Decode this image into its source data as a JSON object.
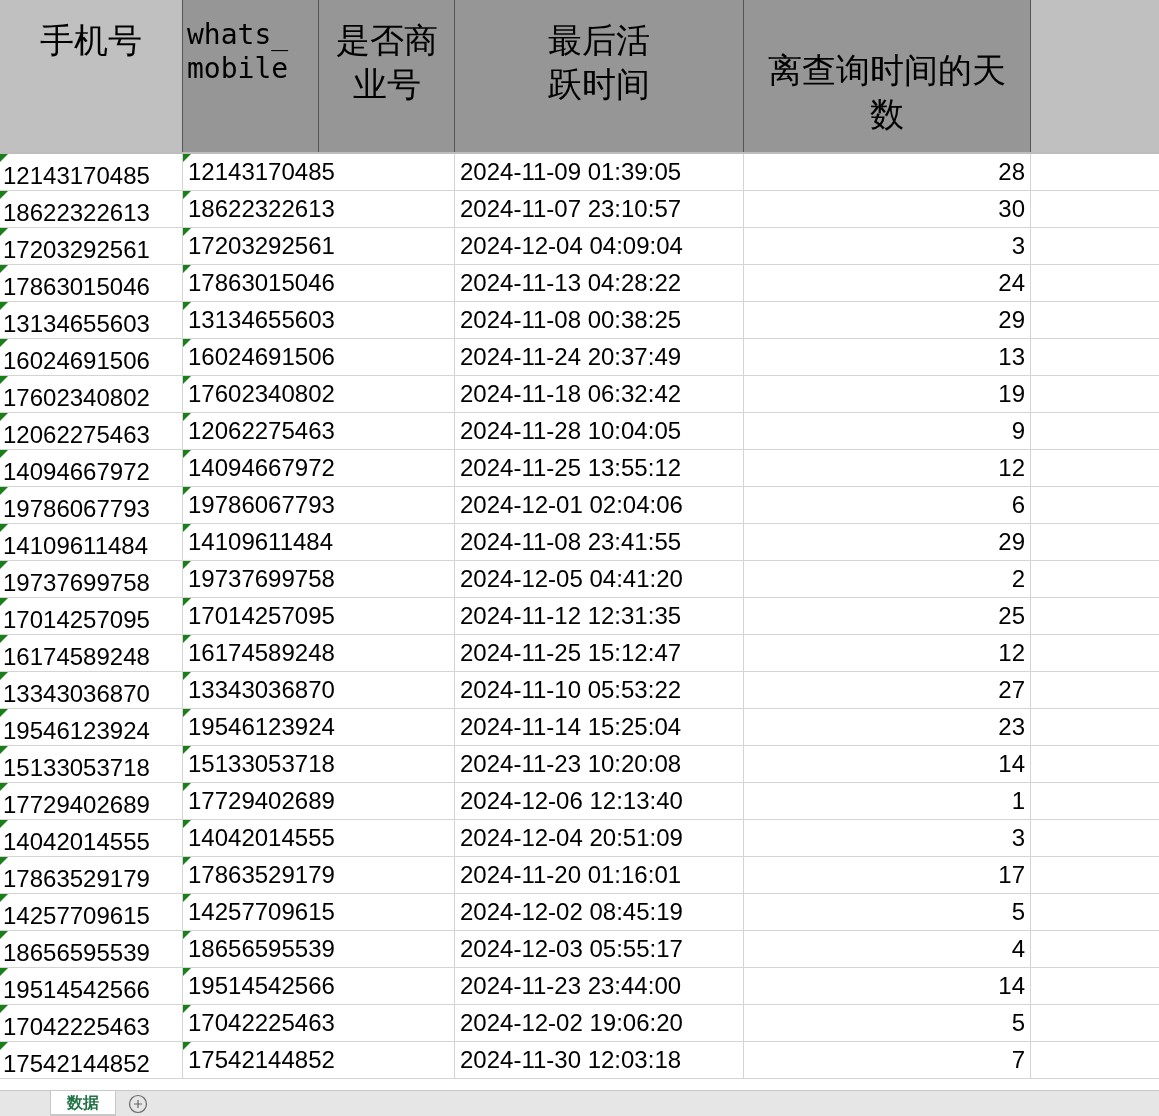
{
  "table": {
    "columns": [
      {
        "label": "手机号",
        "kind": "cjk"
      },
      {
        "label": "whats_mobile",
        "kind": "mono"
      },
      {
        "label": "是否商业号",
        "kind": "cjk"
      },
      {
        "label": "最后活跃时间",
        "kind": "cjk"
      },
      {
        "label": "离查询时间的天数",
        "kind": "cjk"
      }
    ],
    "rows": [
      {
        "phone": "12143170485",
        "whats_mobile": "12143170485",
        "last_active": "2024-11-09 01:39:05",
        "days": "28"
      },
      {
        "phone": "18622322613",
        "whats_mobile": "18622322613",
        "last_active": "2024-11-07 23:10:57",
        "days": "30"
      },
      {
        "phone": "17203292561",
        "whats_mobile": "17203292561",
        "last_active": "2024-12-04 04:09:04",
        "days": "3"
      },
      {
        "phone": "17863015046",
        "whats_mobile": "17863015046",
        "last_active": "2024-11-13 04:28:22",
        "days": "24"
      },
      {
        "phone": "13134655603",
        "whats_mobile": "13134655603",
        "last_active": "2024-11-08 00:38:25",
        "days": "29"
      },
      {
        "phone": "16024691506",
        "whats_mobile": "16024691506",
        "last_active": "2024-11-24 20:37:49",
        "days": "13"
      },
      {
        "phone": "17602340802",
        "whats_mobile": "17602340802",
        "last_active": "2024-11-18 06:32:42",
        "days": "19"
      },
      {
        "phone": "12062275463",
        "whats_mobile": "12062275463",
        "last_active": "2024-11-28 10:04:05",
        "days": "9"
      },
      {
        "phone": "14094667972",
        "whats_mobile": "14094667972",
        "last_active": "2024-11-25 13:55:12",
        "days": "12"
      },
      {
        "phone": "19786067793",
        "whats_mobile": "19786067793",
        "last_active": "2024-12-01 02:04:06",
        "days": "6"
      },
      {
        "phone": "14109611484",
        "whats_mobile": "14109611484",
        "last_active": "2024-11-08 23:41:55",
        "days": "29"
      },
      {
        "phone": "19737699758",
        "whats_mobile": "19737699758",
        "last_active": "2024-12-05 04:41:20",
        "days": "2"
      },
      {
        "phone": "17014257095",
        "whats_mobile": "17014257095",
        "last_active": "2024-11-12 12:31:35",
        "days": "25"
      },
      {
        "phone": "16174589248",
        "whats_mobile": "16174589248",
        "last_active": "2024-11-25 15:12:47",
        "days": "12"
      },
      {
        "phone": "13343036870",
        "whats_mobile": "13343036870",
        "last_active": "2024-11-10 05:53:22",
        "days": "27"
      },
      {
        "phone": "19546123924",
        "whats_mobile": "19546123924",
        "last_active": "2024-11-14 15:25:04",
        "days": "23"
      },
      {
        "phone": "15133053718",
        "whats_mobile": "15133053718",
        "last_active": "2024-11-23 10:20:08",
        "days": "14"
      },
      {
        "phone": "17729402689",
        "whats_mobile": "17729402689",
        "last_active": "2024-12-06 12:13:40",
        "days": "1"
      },
      {
        "phone": "14042014555",
        "whats_mobile": "14042014555",
        "last_active": "2024-12-04 20:51:09",
        "days": "3"
      },
      {
        "phone": "17863529179",
        "whats_mobile": "17863529179",
        "last_active": "2024-11-20 01:16:01",
        "days": "17"
      },
      {
        "phone": "14257709615",
        "whats_mobile": "14257709615",
        "last_active": "2024-12-02 08:45:19",
        "days": "5"
      },
      {
        "phone": "18656595539",
        "whats_mobile": "18656595539",
        "last_active": "2024-12-03 05:55:17",
        "days": "4"
      },
      {
        "phone": "19514542566",
        "whats_mobile": "19514542566",
        "last_active": "2024-11-23 23:44:00",
        "days": "14"
      },
      {
        "phone": "17042225463",
        "whats_mobile": "17042225463",
        "last_active": "2024-12-02 19:06:20",
        "days": "5"
      },
      {
        "phone": "17542144852",
        "whats_mobile": "17542144852",
        "last_active": "2024-11-30 12:03:18",
        "days": "7"
      }
    ]
  },
  "sheet_tabs": [
    {
      "label": "数据",
      "selected": true
    }
  ]
}
